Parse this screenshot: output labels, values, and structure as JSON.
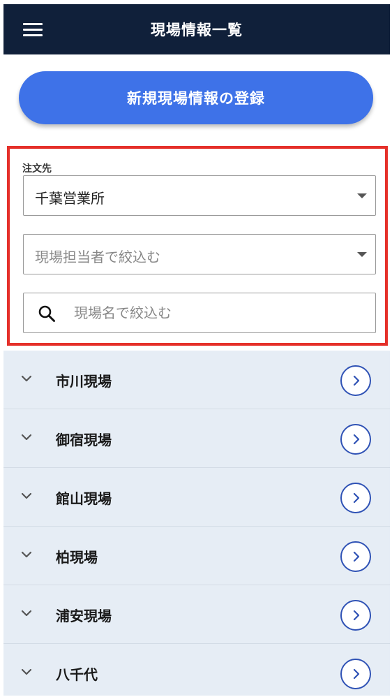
{
  "header": {
    "title": "現場情報一覧"
  },
  "register": {
    "label": "新規現場情報の登録"
  },
  "filter": {
    "orderer_label": "注文先",
    "orderer_value": "千葉営業所",
    "person_placeholder": "現場担当者で絞込む",
    "search_placeholder": "現場名で絞込む"
  },
  "sites": [
    {
      "name": "市川現場"
    },
    {
      "name": "御宿現場"
    },
    {
      "name": "館山現場"
    },
    {
      "name": "柏現場"
    },
    {
      "name": "浦安現場"
    },
    {
      "name": "八千代"
    }
  ],
  "icons": {
    "menu": "hamburger-menu-icon",
    "search": "search-icon",
    "expand": "chevron-down-icon",
    "open": "chevron-right-circle-icon"
  },
  "colors": {
    "header_bg": "#10203a",
    "primary_button": "#3e72e8",
    "highlight_border": "#e5302a",
    "list_bg": "#e6edf5",
    "arrow_accent": "#2f52b5"
  }
}
